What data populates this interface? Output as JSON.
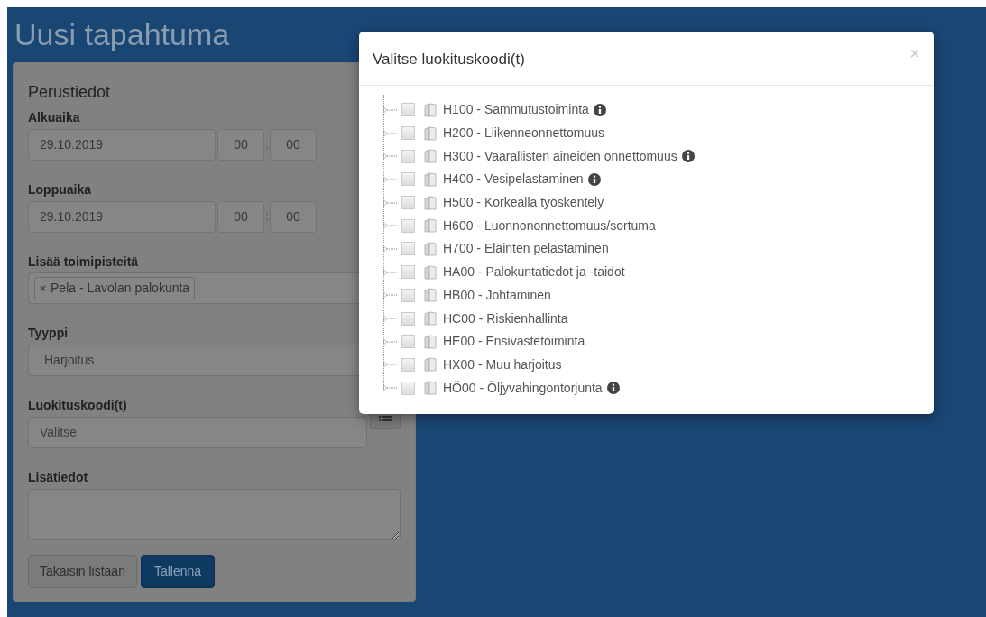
{
  "page_title": "Uusi tapahtuma",
  "form": {
    "section_title": "Perustiedot",
    "start": {
      "label": "Alkuaika",
      "date": "29.10.2019",
      "hour": "00",
      "separator": ":",
      "minute": "00"
    },
    "end": {
      "label": "Loppuaika",
      "date": "29.10.2019",
      "hour": "00",
      "separator": ":",
      "minute": "00"
    },
    "units": {
      "label": "Lisää toimipisteitä",
      "tags": [
        {
          "remove": "×",
          "text": "Pela - Lavolan palokunta"
        }
      ]
    },
    "type": {
      "label": "Tyyppi",
      "value": "Harjoitus"
    },
    "codes": {
      "label": "Luokituskoodi(t)",
      "placeholder": "Valitse"
    },
    "notes": {
      "label": "Lisätiedot"
    },
    "buttons": [
      {
        "label": "Takaisin listaan",
        "kind": "secondary"
      },
      {
        "label": "Tallenna",
        "kind": "primary"
      }
    ]
  },
  "modal": {
    "title": "Valitse luokituskoodi(t)",
    "close": "×",
    "items": [
      {
        "label": "H100 - Sammutustoiminta",
        "checked": false,
        "info": true
      },
      {
        "label": "H200 - Liikenneonnettomuus",
        "checked": false,
        "info": false
      },
      {
        "label": "H300 - Vaarallisten aineiden onnettomuus",
        "checked": false,
        "info": true
      },
      {
        "label": "H400 - Vesipelastaminen",
        "checked": false,
        "info": true
      },
      {
        "label": "H500 - Korkealla työskentely",
        "checked": false,
        "info": false
      },
      {
        "label": "H600 - Luonnononnettomuus/sortuma",
        "checked": false,
        "info": false
      },
      {
        "label": "H700 - Eläinten pelastaminen",
        "checked": false,
        "info": false
      },
      {
        "label": "HA00 - Palokuntatiedot ja -taidot",
        "checked": false,
        "info": false
      },
      {
        "label": "HB00 - Johtaminen",
        "checked": false,
        "info": false
      },
      {
        "label": "HC00 - Riskienhallinta",
        "checked": false,
        "info": false
      },
      {
        "label": "HE00 - Ensivastetoiminta",
        "checked": false,
        "info": false
      },
      {
        "label": "HX00 - Muu harjoitus",
        "checked": false,
        "info": false
      },
      {
        "label": "HÖ00 - Öljyvahingontorjunta",
        "checked": false,
        "info": true
      }
    ]
  }
}
